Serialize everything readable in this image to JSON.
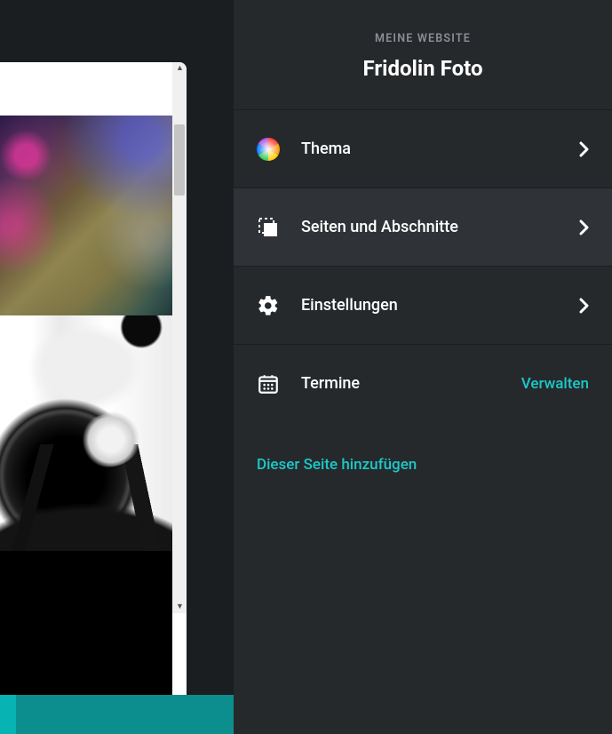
{
  "sidebar": {
    "eyebrow": "MEINE WEBSITE",
    "site_title": "Fridolin Foto",
    "items": [
      {
        "label": "Thema"
      },
      {
        "label": "Seiten und Abschnitte"
      },
      {
        "label": "Einstellungen"
      },
      {
        "label": "Termine",
        "action": "Verwalten"
      }
    ],
    "add_to_page": "Dieser Seite hinzufügen"
  },
  "colors": {
    "accent": "#1cc8c8",
    "panel": "#26292c",
    "panel_active": "#2f3337",
    "background": "#1b1e21"
  }
}
